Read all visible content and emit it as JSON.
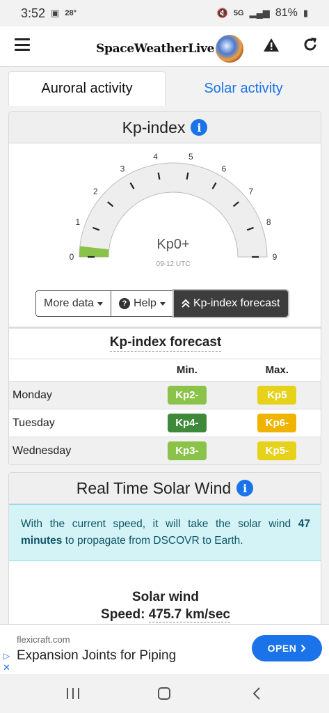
{
  "status_bar": {
    "time": "3:52",
    "temperature": "28°",
    "network": "5G",
    "battery": "81%"
  },
  "app_bar": {
    "brand": "SpaceWeatherLive"
  },
  "tabs": [
    {
      "label": "Auroral activity",
      "active": true
    },
    {
      "label": "Solar activity",
      "active": false
    }
  ],
  "kp_card": {
    "title": "Kp-index",
    "gauge": {
      "value_label": "Kp0+",
      "time_label": "09-12 UTC",
      "ticks": [
        "0",
        "1",
        "2",
        "3",
        "4",
        "5",
        "6",
        "7",
        "8",
        "9"
      ],
      "value": 0.33,
      "max": 9,
      "fill_color": "#8bc34a"
    },
    "buttons": {
      "more_data": "More data",
      "help": "Help",
      "forecast": "Kp-index forecast"
    }
  },
  "forecast": {
    "title": "Kp-index forecast",
    "col_min": "Min.",
    "col_max": "Max.",
    "rows": [
      {
        "day": "Monday",
        "min": "Kp2-",
        "min_color": "#8bc34a",
        "max": "Kp5",
        "max_color": "#e6d21a"
      },
      {
        "day": "Tuesday",
        "min": "Kp4-",
        "min_color": "#3f8a3a",
        "max": "Kp6-",
        "max_color": "#f0b400"
      },
      {
        "day": "Wednesday",
        "min": "Kp3-",
        "min_color": "#8bc34a",
        "max": "Kp5-",
        "max_color": "#e6d21a"
      }
    ]
  },
  "solar_wind": {
    "title": "Real Time Solar Wind",
    "alert_pre": "With the current speed, it will take the solar wind ",
    "alert_bold": "47 minutes",
    "alert_post": " to propagate from DSCOVR to Earth.",
    "label": "Solar wind",
    "speed_prefix": "Speed:",
    "speed_value": "475.7 km/sec"
  },
  "ad": {
    "domain": "flexicraft.com",
    "headline": "Expansion Joints for Piping",
    "cta": "OPEN"
  }
}
